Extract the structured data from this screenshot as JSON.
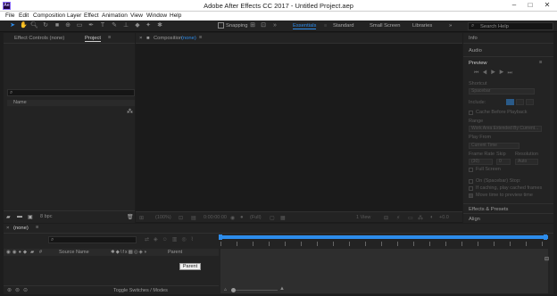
{
  "window": {
    "title": "Adobe After Effects CC 2017 - Untitled Project.aep",
    "app_badge": "Ae"
  },
  "menu": [
    "File",
    "Edit",
    "Composition",
    "Layer",
    "Effect",
    "Animation",
    "View",
    "Window",
    "Help"
  ],
  "toolbar": {
    "snapping_label": "Snapping",
    "workspaces": [
      "Essentials",
      "Standard",
      "Small Screen",
      "Libraries"
    ],
    "active_workspace": "Essentials",
    "overflow": "»",
    "search_placeholder": "Search Help"
  },
  "left_panel": {
    "tab_effect_controls": "Effect Controls (none)",
    "tab_project": "Project",
    "menu_glyph": "≡",
    "column_name": "Name",
    "bpc": "8 bpc"
  },
  "composition": {
    "tab_prefix": "Composition",
    "tab_value": "(none)",
    "zoom": "(100%)",
    "timecode": "0:00:00:00",
    "resolution": "(Full)",
    "view": "1 View",
    "exposure": "+0.0"
  },
  "right_panel": {
    "info": "Info",
    "audio": "Audio",
    "preview": "Preview",
    "shortcut_label": "Shortcut",
    "shortcut_value": "Spacebar",
    "include_label": "Include:",
    "cache_label": "Cache Before Playback",
    "range_label": "Range",
    "range_value": "Work Area Extended By Current...",
    "play_from_label": "Play From",
    "play_from_value": "Current Time",
    "frame_rate_label": "Frame Rate",
    "skip_label": "Skip",
    "resolution_label": "Resolution",
    "frame_rate_value": "(30)",
    "skip_value": "0",
    "resolution_value": "Auto",
    "full_screen_label": "Full Screen",
    "on_stop_label": "On (Spacebar) Stop:",
    "if_caching_label": "If caching, play cached frames",
    "move_time_label": "Move time to preview time",
    "effects_presets": "Effects & Presets",
    "align": "Align"
  },
  "timeline": {
    "tab_label": "(none)",
    "col_source_name": "Source Name",
    "col_parent": "Parent",
    "tooltip": "Parent",
    "toggle_label": "Toggle Switches / Modes"
  },
  "colors": {
    "accent_blue": "#2d8ceb",
    "panel_bg": "#232323",
    "frame_bg": "#1d1d1d"
  }
}
